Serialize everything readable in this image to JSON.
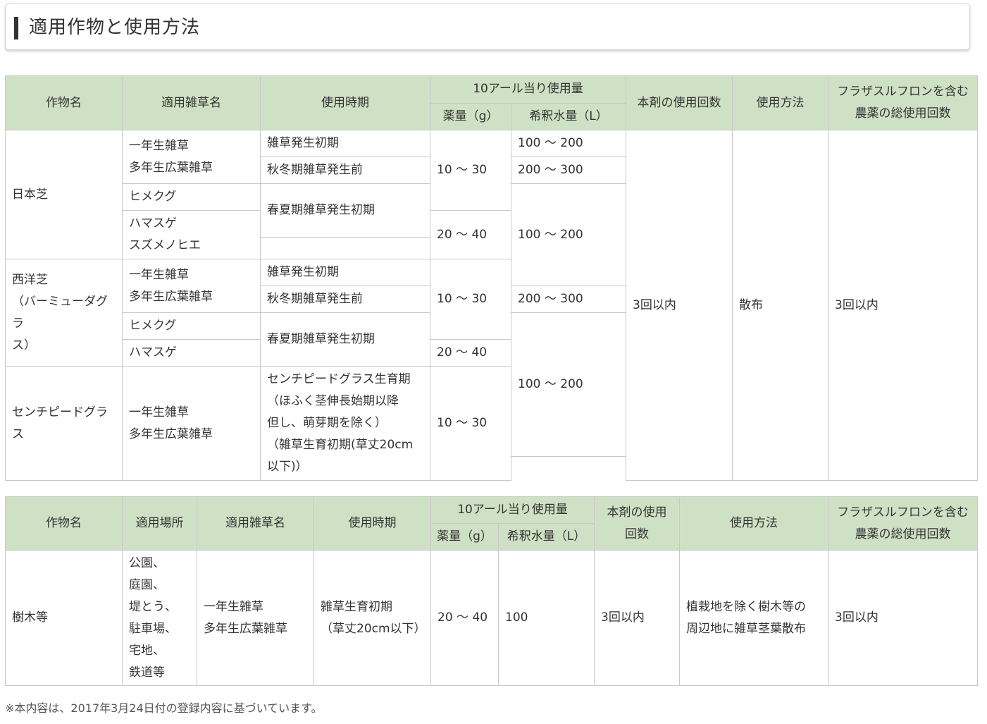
{
  "section_title": "適用作物と使用方法",
  "table1": {
    "headers": {
      "crop": "作物名",
      "weed": "適用雑草名",
      "timing": "使用時期",
      "per10a": "10アール当り使用量",
      "drug": "薬量（g）",
      "water": "希釈水量（L）",
      "times": "本剤の使用回数",
      "method": "使用方法",
      "total": [
        "フラザスルフロンを含む",
        "農薬の総使用回数"
      ]
    },
    "crop_nihonshiba": "日本芝",
    "crop_seiyoushiba": [
      "西洋芝",
      "（バーミューダグラ",
      "ス）"
    ],
    "crop_centipede": "センチピードグラス",
    "weed_annual_broadleaf": [
      "一年生雑草",
      "多年生広葉雑草"
    ],
    "weed_himekugu": "ヒメクグ",
    "weed_hamasuge_suzumenohie": [
      "ハマスゲ",
      "スズメノヒエ"
    ],
    "weed_hamasuge": "ハマスゲ",
    "timing_early": "雑草発生初期",
    "timing_autumn": "秋冬期雑草発生前",
    "timing_spring": "春夏期雑草発生初期",
    "timing_centipede": [
      "センチピードグラス生育期",
      "（ほふく茎伸長始期以降",
      "但し、萌芽期を除く）",
      "（雑草生育初期(草丈20cm",
      "以下)）"
    ],
    "drug_10_30": "10 ～ 30",
    "drug_20_40": "20 ～ 40",
    "water_100_200": "100 ～ 200",
    "water_200_300": "200 ～ 300",
    "times": "3回以内",
    "method": "散布",
    "total": "3回以内"
  },
  "table2": {
    "headers": {
      "crop": "作物名",
      "place": "適用場所",
      "weed": "適用雑草名",
      "timing": "使用時期",
      "per10a": "10アール当り使用量",
      "drug": "薬量（g）",
      "water": "希釈水量（L）",
      "times": [
        "本剤の使用",
        "回数"
      ],
      "method": "使用方法",
      "total": [
        "フラザスルフロンを含む",
        "農薬の総使用回数"
      ]
    },
    "row": {
      "crop": "樹木等",
      "place": [
        "公園、",
        "庭園、",
        "堤とう、",
        "駐車場、",
        "宅地、",
        "鉄道等"
      ],
      "weed": [
        "一年生雑草",
        "多年生広葉雑草"
      ],
      "timing": [
        "雑草生育初期",
        "（草丈20cm以下）"
      ],
      "drug": "20 ～ 40",
      "water": "100",
      "times": "3回以内",
      "method": [
        "植栽地を除く樹木等の",
        "周辺地に雑草茎葉散布"
      ],
      "total": "3回以内"
    }
  },
  "footnote": "※本内容は、2017年3月24日付の登録内容に基づいています。"
}
